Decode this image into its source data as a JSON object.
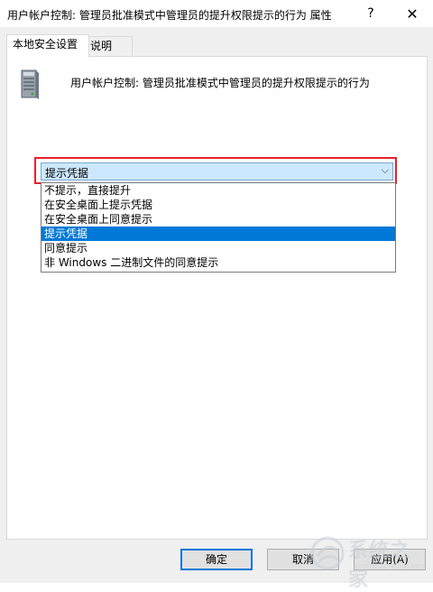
{
  "window": {
    "title": "用户帐户控制: 管理员批准模式中管理员的提升权限提示的行为 属性",
    "help_glyph": "?",
    "close_glyph": "✕"
  },
  "tabs": [
    {
      "label": "本地安全设置",
      "active": true
    },
    {
      "label": "说明",
      "active": false
    }
  ],
  "policy": {
    "icon": "server-icon",
    "name": "用户帐户控制: 管理员批准模式中管理员的提升权限提示的行为"
  },
  "combo": {
    "selected": "提示凭据",
    "arrow": "⌵",
    "options": [
      {
        "label": "不提示，直接提升"
      },
      {
        "label": "在安全桌面上提示凭据"
      },
      {
        "label": "在安全桌面上同意提示"
      },
      {
        "label": "提示凭据"
      },
      {
        "label": "同意提示"
      },
      {
        "label": "非 Windows 二进制文件的同意提示"
      }
    ],
    "selected_index": 3
  },
  "buttons": {
    "ok": "确定",
    "cancel": "取消",
    "apply": "应用(A)"
  },
  "watermark": {
    "text": "系统之家",
    "sub": "XITONGZHIJIA.NET"
  },
  "colors": {
    "highlight": "#0078d7",
    "combo_bg": "#cce8ff",
    "annotation_red": "#e8212b"
  }
}
